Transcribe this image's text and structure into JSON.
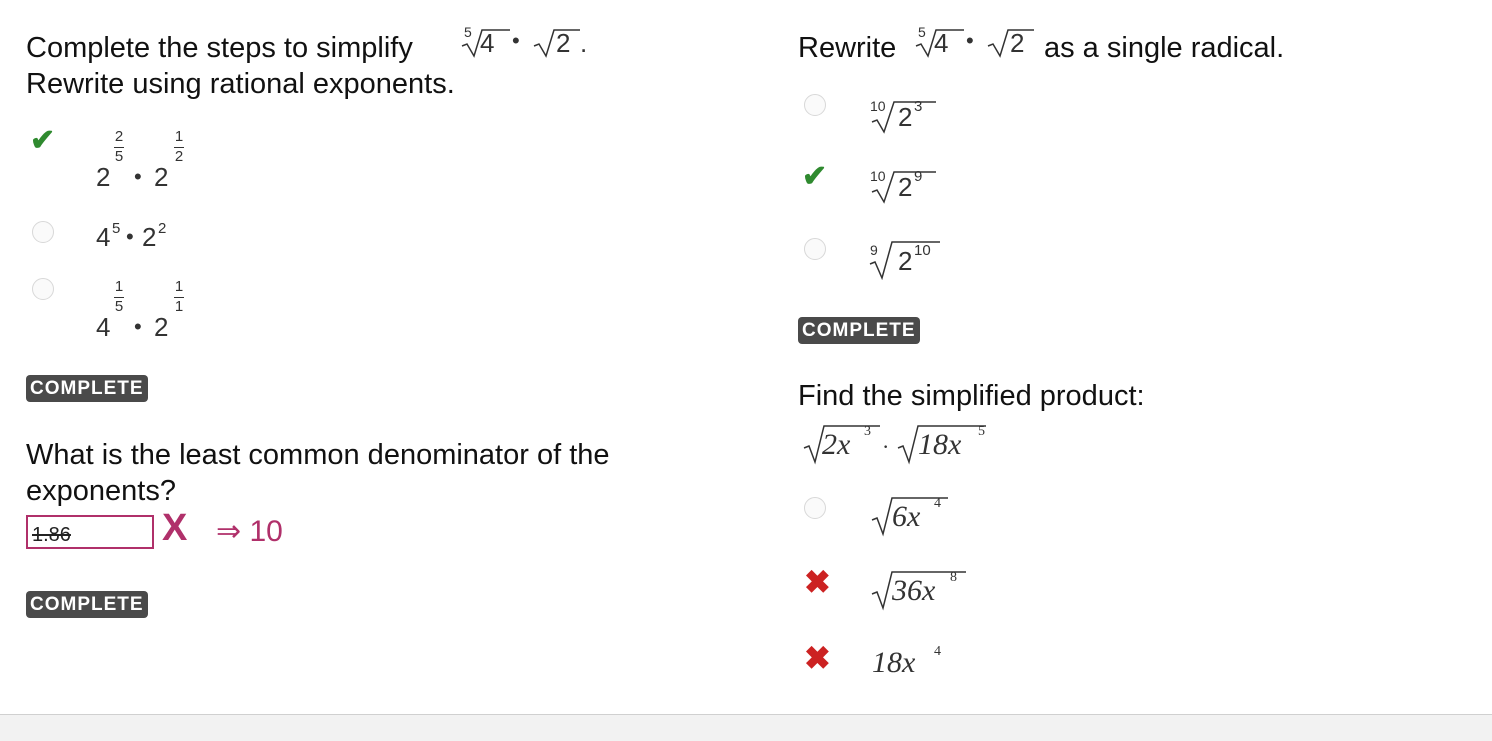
{
  "left": {
    "q1": {
      "line1": "Complete the steps to simplify",
      "line2": "Rewrite using rational exponents.",
      "expr": {
        "idx": "5",
        "rad1": "4",
        "dot": "•",
        "rad2": "2",
        "period": "."
      },
      "options": [
        {
          "base1": "2",
          "num1": "2",
          "den1": "5",
          "dot": "•",
          "base2": "2",
          "num2": "1",
          "den2": "2",
          "state": "correct"
        },
        {
          "base1": "4",
          "exp1": "5",
          "dot": "•",
          "base2": "2",
          "exp2": "2",
          "state": "unselected"
        },
        {
          "base1": "4",
          "num1": "1",
          "den1": "5",
          "dot": "•",
          "base2": "2",
          "num2": "1",
          "den2": "1",
          "state": "unselected"
        }
      ],
      "status": "COMPLETE"
    },
    "q2": {
      "line1": "What is the least common denominator of the",
      "line2": "exponents?",
      "input_value": "1.86",
      "answer": "⇒ 10",
      "status": "COMPLETE"
    }
  },
  "right": {
    "q3": {
      "prefix": "Rewrite",
      "suffix": "as a single radical.",
      "expr": {
        "idx": "5",
        "rad1": "4",
        "dot": "•",
        "rad2": "2"
      },
      "options": [
        {
          "idx": "10",
          "base": "2",
          "exp": "3",
          "state": "unselected"
        },
        {
          "idx": "10",
          "base": "2",
          "exp": "9",
          "state": "correct"
        },
        {
          "idx": "9",
          "base": "2",
          "exp": "10",
          "state": "unselected"
        }
      ],
      "status": "COMPLETE"
    },
    "q4": {
      "line1": "Find the simplified product:",
      "expr": {
        "rad1": "2x",
        "exp1": "3",
        "dot": "·",
        "rad2": "18x",
        "exp2": "5"
      },
      "options": [
        {
          "coef": "6x",
          "exp": "4",
          "state": "unselected"
        },
        {
          "coef": "36x",
          "exp": "8",
          "state": "incorrect"
        },
        {
          "coef": "18x",
          "exp": "4",
          "state": "incorrect"
        }
      ]
    }
  },
  "icons": {
    "check": "check-icon",
    "incorrect": "x-icon",
    "accent_check": "#2f8a2f",
    "accent_wrong": "#c22222",
    "accent_input": "#b0306a"
  }
}
